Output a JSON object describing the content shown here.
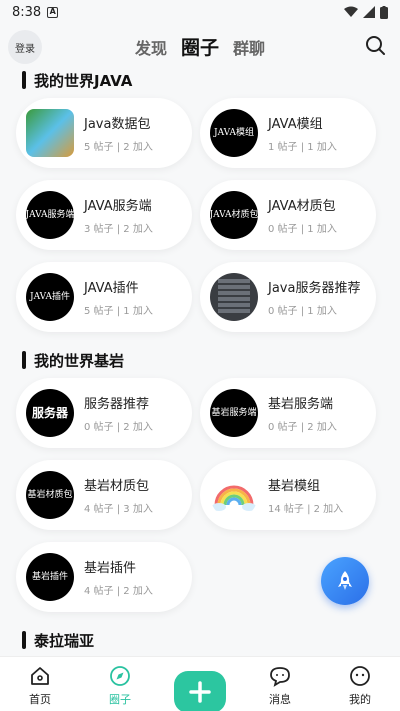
{
  "status": {
    "time": "8:38"
  },
  "header": {
    "login_label": "登录",
    "tabs": [
      {
        "label": "发现"
      },
      {
        "label": "圈子",
        "active": true
      },
      {
        "label": "群聊"
      }
    ]
  },
  "sections": [
    {
      "title": "我的世界JAVA",
      "items": [
        {
          "name": "Java数据包",
          "posts": "5 帖子",
          "joined": "2 加入",
          "avatar": ""
        },
        {
          "name": "JAVA模组",
          "posts": "1 帖子",
          "joined": "1 加入",
          "avatar": "JAVA模组"
        },
        {
          "name": "JAVA服务端",
          "posts": "3 帖子",
          "joined": "2 加入",
          "avatar": "JAVA服务端"
        },
        {
          "name": "JAVA材质包",
          "posts": "0 帖子",
          "joined": "1 加入",
          "avatar": "JAVA材质包"
        },
        {
          "name": "JAVA插件",
          "posts": "5 帖子",
          "joined": "1 加入",
          "avatar": "JAVA插件"
        },
        {
          "name": "Java服务器推荐",
          "posts": "0 帖子",
          "joined": "1 加入",
          "avatar": ""
        }
      ]
    },
    {
      "title": "我的世界基岩",
      "items": [
        {
          "name": "服务器推荐",
          "posts": "0 帖子",
          "joined": "2 加入",
          "avatar": "服务器"
        },
        {
          "name": "基岩服务端",
          "posts": "0 帖子",
          "joined": "2 加入",
          "avatar": "基岩服务端"
        },
        {
          "name": "基岩材质包",
          "posts": "4 帖子",
          "joined": "3 加入",
          "avatar": "基岩材质包"
        },
        {
          "name": "基岩模组",
          "posts": "14 帖子",
          "joined": "2 加入",
          "avatar": ""
        },
        {
          "name": "基岩插件",
          "posts": "4 帖子",
          "joined": "2 加入",
          "avatar": "基岩插件"
        }
      ]
    },
    {
      "title": "泰拉瑞亚",
      "items": []
    }
  ],
  "bottom_nav": [
    {
      "label": "首页",
      "icon": "home-icon"
    },
    {
      "label": "圈子",
      "icon": "compass-icon",
      "active": true
    },
    {
      "label": "",
      "icon": "plus-icon"
    },
    {
      "label": "消息",
      "icon": "message-icon"
    },
    {
      "label": "我的",
      "icon": "profile-icon"
    }
  ],
  "colors": {
    "accent": "#2cc6a0",
    "fab": "#2b6fe8"
  }
}
